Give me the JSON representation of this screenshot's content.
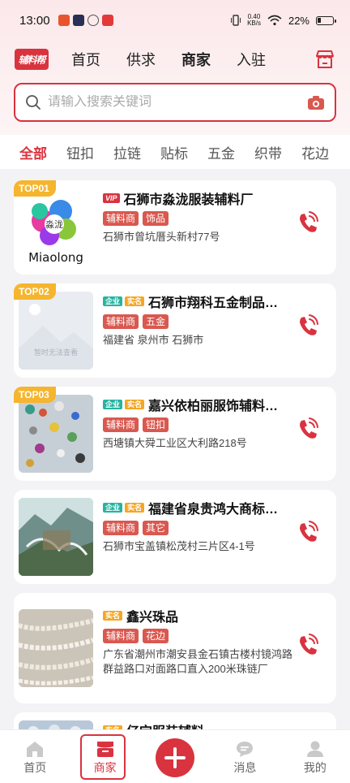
{
  "status_bar": {
    "time": "13:00",
    "net_speed_value": "0.40",
    "net_speed_unit": "KB/s",
    "battery": "22%"
  },
  "header": {
    "logo_text": "辅料帮",
    "tabs": [
      {
        "label": "首页",
        "active": false
      },
      {
        "label": "供求",
        "active": false
      },
      {
        "label": "商家",
        "active": true
      },
      {
        "label": "入驻",
        "active": false
      }
    ],
    "store_icon": "store-icon"
  },
  "search": {
    "placeholder": "请输入搜索关键词",
    "value": "",
    "icon": "search-icon",
    "camera_icon": "camera-icon"
  },
  "categories": [
    {
      "label": "全部",
      "active": true
    },
    {
      "label": "钮扣"
    },
    {
      "label": "拉链"
    },
    {
      "label": "贴标"
    },
    {
      "label": "五金"
    },
    {
      "label": "织带"
    },
    {
      "label": "花边"
    }
  ],
  "merchants": [
    {
      "rank": "TOP01",
      "badges": [
        "VIP"
      ],
      "name": "石狮市淼泷服装辅料厂",
      "tags": [
        "辅料商",
        "饰品"
      ],
      "address": "石狮市曾坑厝头新村77号",
      "thumb_text": "Miaolong",
      "thumb_sub": "淼泷"
    },
    {
      "rank": "TOP02",
      "badges": [
        "企业",
        "实名"
      ],
      "name": "石狮市翔科五金制品…",
      "tags": [
        "辅料商",
        "五金"
      ],
      "address": "福建省 泉州市 石狮市",
      "thumb_text": "暂时无法查看"
    },
    {
      "rank": "TOP03",
      "badges": [
        "企业",
        "实名"
      ],
      "name": "嘉兴依柏丽服饰辅料…",
      "tags": [
        "辅料商",
        "钮扣"
      ],
      "address": "西塘镇大舜工业区大利路218号"
    },
    {
      "rank": "",
      "badges": [
        "企业",
        "实名"
      ],
      "name": "福建省泉贵鸿大商标…",
      "tags": [
        "辅料商",
        "其它"
      ],
      "address": "石狮市宝盖镇松茂村三片区4-1号"
    },
    {
      "rank": "",
      "badges": [
        "实名"
      ],
      "name": "鑫兴珠品",
      "tags": [
        "辅料商",
        "花边"
      ],
      "address": "广东省潮州市潮安县金石镇古楼村镜鸿路群益路口对面路口直入200米珠链厂"
    },
    {
      "rank": "",
      "badges": [
        "实名"
      ],
      "name": "亿宝服装辅料",
      "tags": [],
      "address": ""
    }
  ],
  "tabbar": [
    {
      "label": "首页",
      "icon": "home-icon",
      "active": false
    },
    {
      "label": "商家",
      "icon": "shop-icon",
      "active": true
    },
    {
      "label": "",
      "icon": "plus-icon",
      "active": false
    },
    {
      "label": "消息",
      "icon": "message-icon",
      "active": false
    },
    {
      "label": "我的",
      "icon": "profile-icon",
      "active": false
    }
  ],
  "colors": {
    "accent": "#d9333f",
    "top_badge": "#f5b52e",
    "tag_bg": "#d9584f",
    "enterprise_badge": "#27b3a0",
    "realname_badge": "#f5a623"
  }
}
